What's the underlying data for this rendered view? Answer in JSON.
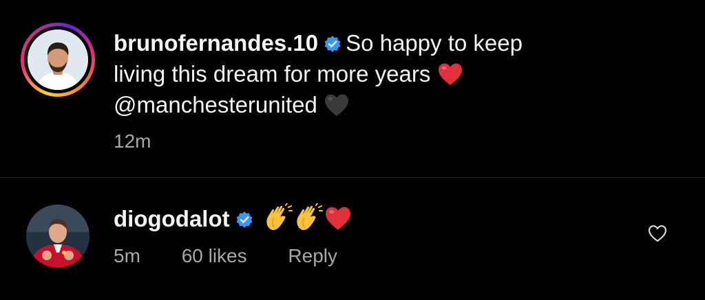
{
  "caption": {
    "username": "brunofernandes.10",
    "text_line1": "So happy to keep",
    "text_line2": "living this dream for more years",
    "mention": "@manchesterunited",
    "time": "12m"
  },
  "comment": {
    "username": "diogodalot",
    "time": "5m",
    "likes": "60 likes",
    "reply_label": "Reply"
  },
  "icons": {
    "verified": "verified-badge-icon",
    "red_heart": "red-heart-emoji",
    "black_heart": "black-heart-emoji",
    "clap": "clapping-hands-emoji",
    "like": "heart-outline-icon"
  },
  "colors": {
    "background": "#000000",
    "text": "#f5f5f5",
    "secondary_text": "#a8a8a8",
    "verified_blue": "#3897f0",
    "heart_red": "#e0303a"
  }
}
